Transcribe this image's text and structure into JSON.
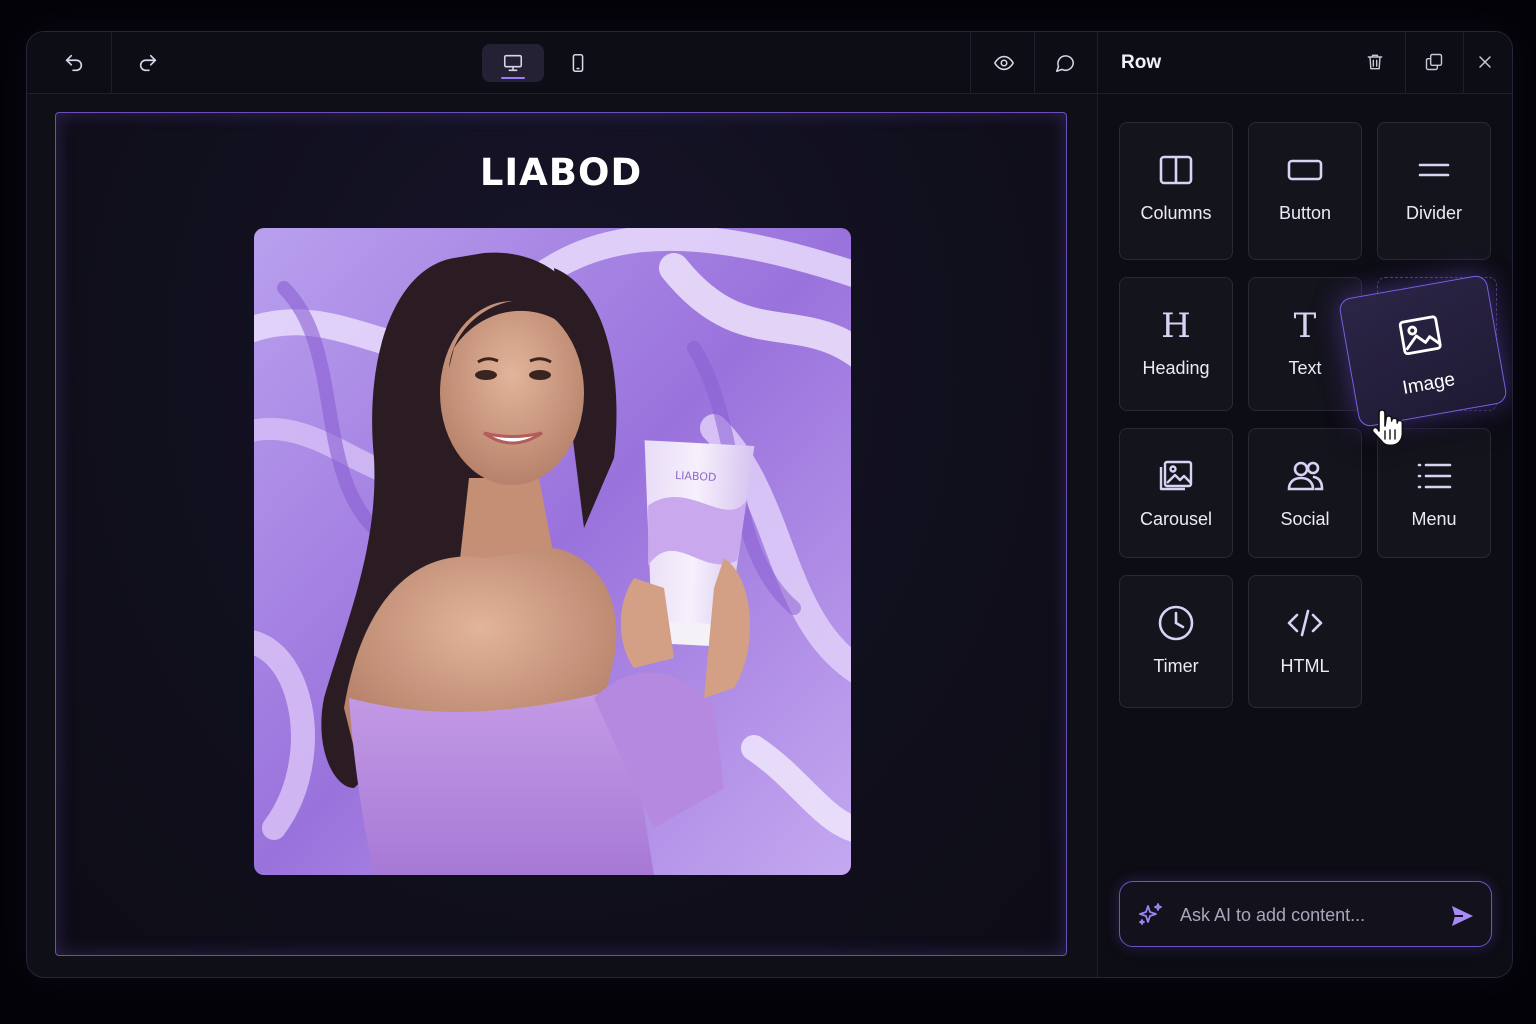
{
  "toolbar": {
    "undo_icon": "undo-icon",
    "redo_icon": "redo-icon",
    "desktop_icon": "desktop-icon",
    "mobile_icon": "mobile-icon",
    "preview_icon": "eye-icon",
    "comment_icon": "comment-icon",
    "active_device": "desktop"
  },
  "canvas": {
    "brand_title": "LIABOD",
    "product_label": "LIABOD"
  },
  "panel": {
    "title": "Row",
    "actions": [
      "trash-icon",
      "duplicate-icon",
      "close-icon"
    ],
    "blocks": [
      {
        "label": "Columns",
        "icon": "columns-icon"
      },
      {
        "label": "Button",
        "icon": "button-icon"
      },
      {
        "label": "Divider",
        "icon": "divider-icon"
      },
      {
        "label": "Heading",
        "icon": "heading-icon"
      },
      {
        "label": "Text",
        "icon": "text-icon"
      },
      {
        "label": "Image",
        "icon": "image-icon",
        "state": "dragging"
      },
      {
        "label": "Carousel",
        "icon": "carousel-icon"
      },
      {
        "label": "Social",
        "icon": "social-icon"
      },
      {
        "label": "Menu",
        "icon": "menu-icon"
      },
      {
        "label": "Timer",
        "icon": "timer-icon"
      },
      {
        "label": "HTML",
        "icon": "code-icon"
      }
    ]
  },
  "ai": {
    "placeholder": "Ask AI to add content..."
  },
  "colors": {
    "accent": "#9b7cf2",
    "background": "#0f0f17",
    "tile": "#14141d"
  }
}
